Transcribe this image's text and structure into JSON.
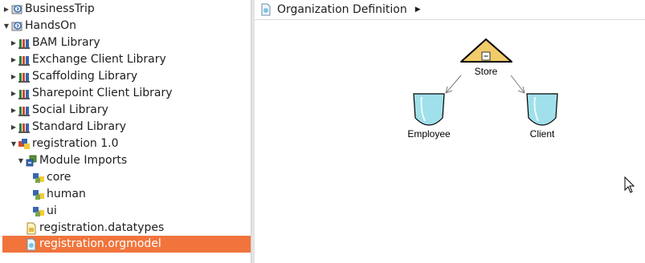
{
  "tree": {
    "items": [
      {
        "label": "BusinessTrip",
        "icon": "project-icon"
      },
      {
        "label": "HandsOn",
        "icon": "project-icon"
      },
      {
        "label": "BAM Library",
        "icon": "library-icon"
      },
      {
        "label": "Exchange Client Library",
        "icon": "library-icon"
      },
      {
        "label": "Scaffolding Library",
        "icon": "library-icon"
      },
      {
        "label": "Sharepoint Client Library",
        "icon": "library-icon"
      },
      {
        "label": "Social Library",
        "icon": "library-icon"
      },
      {
        "label": "Standard Library",
        "icon": "library-icon"
      },
      {
        "label": "registration 1.0",
        "icon": "module-icon"
      },
      {
        "label": "Module Imports",
        "icon": "imports-icon"
      },
      {
        "label": "core",
        "icon": "imported-module-icon"
      },
      {
        "label": "human",
        "icon": "imported-module-icon"
      },
      {
        "label": "ui",
        "icon": "imported-module-icon"
      },
      {
        "label": "registration.datatypes",
        "icon": "datatypes-file-icon"
      },
      {
        "label": "registration.orgmodel",
        "icon": "orgmodel-file-icon",
        "selected": true
      }
    ]
  },
  "editor": {
    "breadcrumb": "Organization Definition"
  },
  "diagram": {
    "nodes": {
      "store": {
        "label": "Store"
      },
      "employee": {
        "label": "Employee"
      },
      "client": {
        "label": "Client"
      }
    },
    "colors": {
      "store_fill": "#f2cc6a",
      "role_fill": "#9fe0ea",
      "selection": "#f0743c"
    }
  }
}
